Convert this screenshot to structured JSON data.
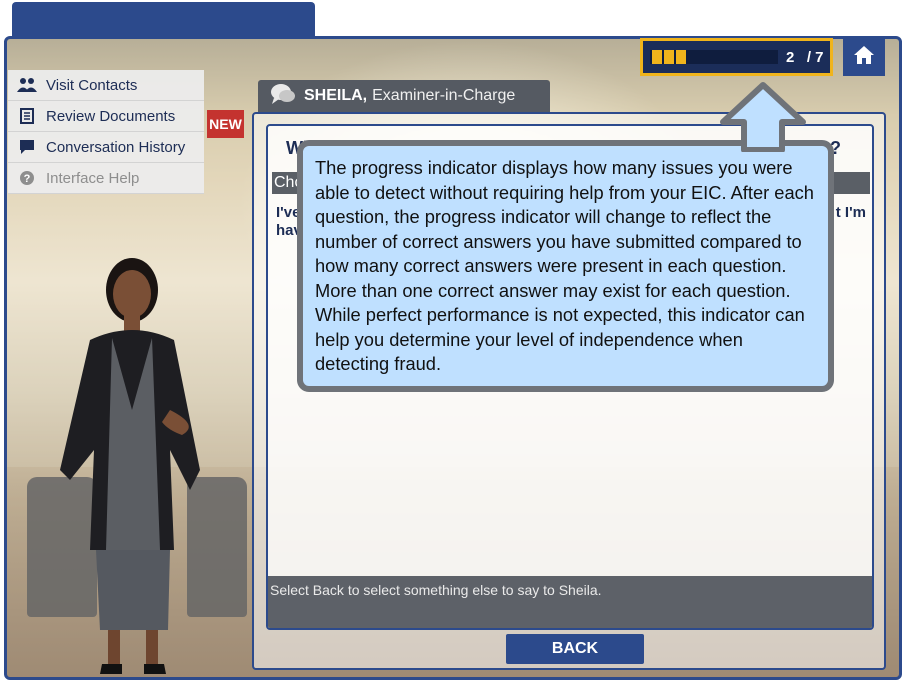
{
  "menu": {
    "items": [
      {
        "label": "Visit Contacts",
        "icon": "people-icon"
      },
      {
        "label": "Review Documents",
        "icon": "document-icon"
      },
      {
        "label": "Conversation History",
        "icon": "chat-icon"
      },
      {
        "label": "Interface Help",
        "icon": "help-icon"
      }
    ],
    "new_badge": "NEW"
  },
  "speaker": {
    "name": "SHEILA,",
    "role": "Examiner-in-Charge",
    "icon": "speech-bubble-icon"
  },
  "progress": {
    "current": "2",
    "total": "/ 7",
    "fill_fraction": 0.29,
    "icon_home": "home-icon"
  },
  "dialog": {
    "question": "Wh",
    "question_right": "heila?",
    "choice_bar": "Cho",
    "choice_line1": "I've",
    "choice_line2": "hav",
    "choice_right": "t I'm",
    "footer": "Select Back to select something else to say to Sheila.",
    "back_label": "BACK"
  },
  "callout": {
    "text": "The progress indicator displays how many issues you were able to detect without requiring help from your EIC. After each question, the progress indicator will change to reflect the number of correct answers you have submitted compared to how many correct answers were present in each question. More than one correct answer may exist for each question. While perfect performance is not expected, this indicator can help you determine your level of independence when detecting fraud."
  },
  "colors": {
    "brand": "#2c4a8c",
    "accent": "#f0b41c",
    "badge": "#c4332f",
    "callout_bg": "#bfe0ff"
  }
}
